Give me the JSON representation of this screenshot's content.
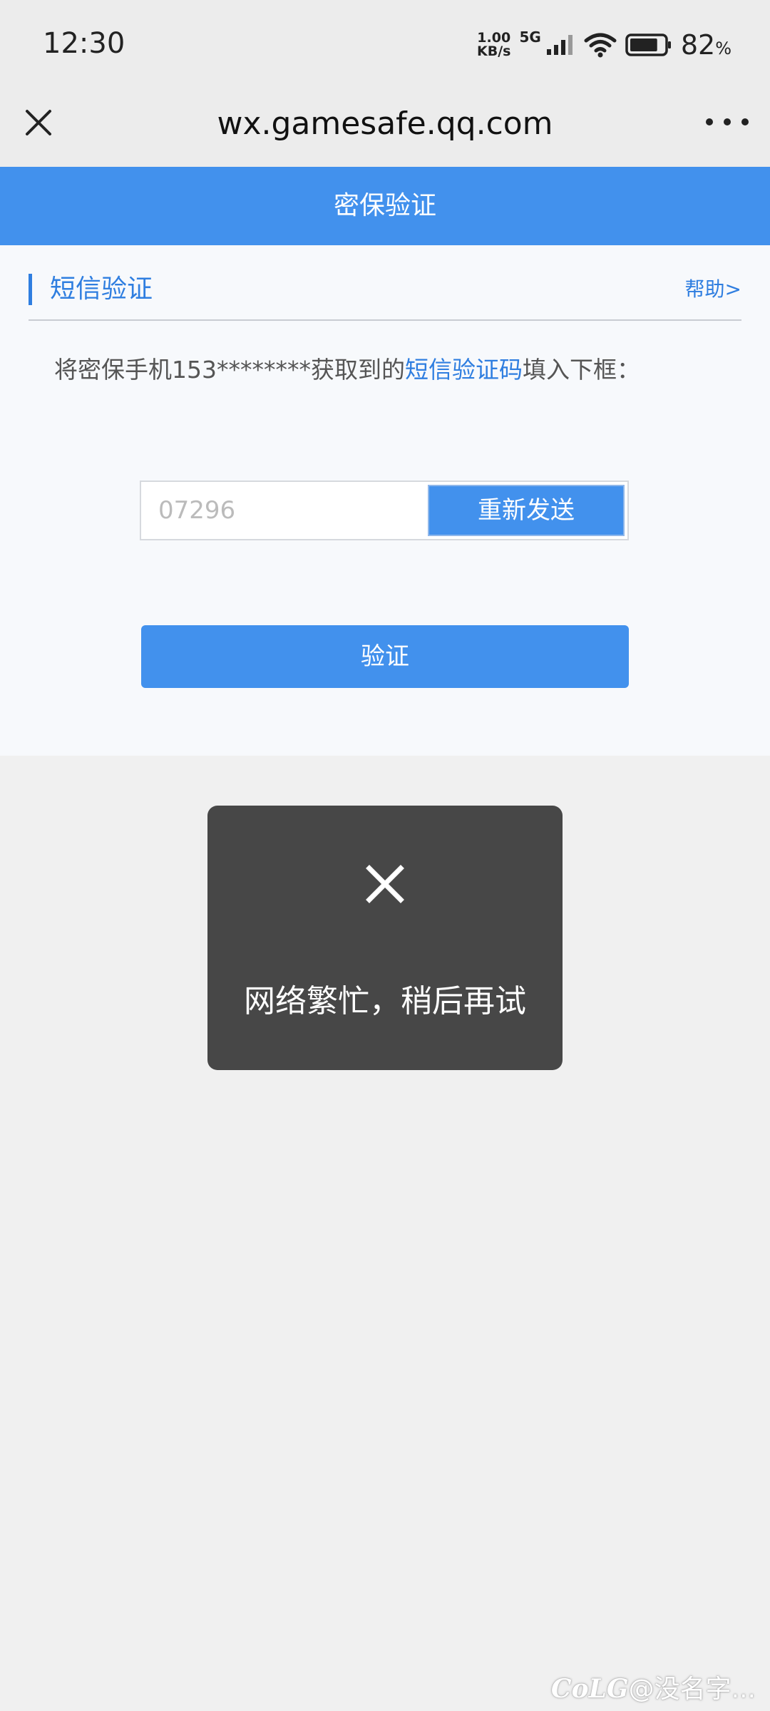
{
  "status_bar": {
    "time": "12:30",
    "net_speed_value": "1.00",
    "net_speed_unit": "KB/s",
    "network_type": "5G",
    "battery_percent": "82",
    "battery_percent_sign": "%",
    "icons": [
      "signal-icon",
      "wifi-icon",
      "battery-icon"
    ],
    "battery_level": 0.82
  },
  "browser": {
    "url": "wx.gamesafe.qq.com",
    "close_icon": "close-icon",
    "more_icon": "more-icon"
  },
  "header": {
    "title": "密保验证"
  },
  "section": {
    "title": "短信验证",
    "help_link": "帮助>"
  },
  "instruction": {
    "prefix": "将密保手机153********获取到的",
    "highlight": "短信验证码",
    "suffix": "填入下框："
  },
  "form": {
    "code_placeholder": "07296",
    "resend_label": "重新发送",
    "verify_label": "验证"
  },
  "toast": {
    "icon": "close-icon",
    "message": "网络繁忙，稍后再试"
  },
  "watermark": {
    "logo": "CoLG",
    "text": "@没名字..."
  },
  "colors": {
    "accent": "#4291ed",
    "link": "#2f7ee0",
    "toast_bg": "#474747",
    "page_bg": "#f0f0f0"
  }
}
